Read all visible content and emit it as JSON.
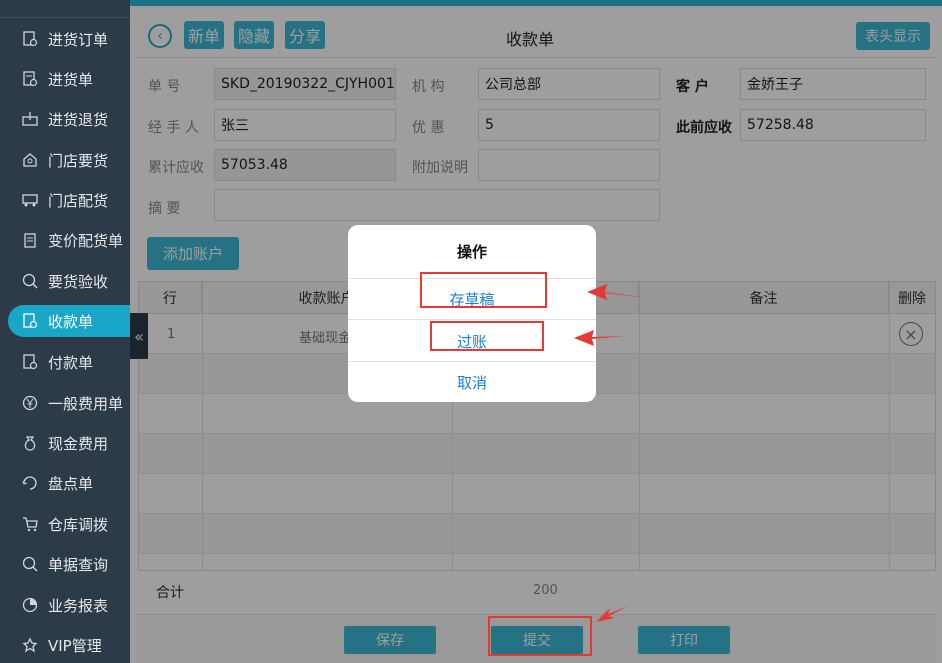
{
  "sidebar": {
    "items": [
      {
        "label": "进货订单",
        "icon": "purchase-order-icon"
      },
      {
        "label": "进货单",
        "icon": "purchase-icon"
      },
      {
        "label": "进货退货",
        "icon": "purchase-return-icon"
      },
      {
        "label": "门店要货",
        "icon": "store-request-icon"
      },
      {
        "label": "门店配货",
        "icon": "store-distribution-icon"
      },
      {
        "label": "变价配货单",
        "icon": "price-change-icon"
      },
      {
        "label": "要货验收",
        "icon": "acceptance-icon"
      },
      {
        "label": "收款单",
        "icon": "receipt-icon"
      },
      {
        "label": "付款单",
        "icon": "payment-icon"
      },
      {
        "label": "一般费用单",
        "icon": "yen-icon"
      },
      {
        "label": "现金费用",
        "icon": "cash-bag-icon"
      },
      {
        "label": "盘点单",
        "icon": "inventory-icon"
      },
      {
        "label": "仓库调拨",
        "icon": "warehouse-transfer-icon"
      },
      {
        "label": "单据查询",
        "icon": "search-doc-icon"
      },
      {
        "label": "业务报表",
        "icon": "pie-chart-icon"
      },
      {
        "label": "VIP管理",
        "icon": "vip-icon"
      }
    ],
    "active_index": 7
  },
  "header": {
    "buttons": [
      "新单",
      "隐藏",
      "分享"
    ],
    "title": "收款单",
    "display_button": "表头显示"
  },
  "form": {
    "doc_no_label": "单    号",
    "doc_no": "SKD_20190322_CJYH001",
    "org_label": "机    构",
    "org": "公司总部",
    "customer_label": "客    户",
    "customer": "金娇王子",
    "handler_label": "经 手 人",
    "handler": "张三",
    "discount_label": "优    惠",
    "discount": "5",
    "prev_receivable_label": "此前应收",
    "prev_receivable": "57258.48",
    "cum_receivable_label": "累计应收",
    "cum_receivable": "57053.48",
    "note_label": "附加说明",
    "note": "",
    "summary_label": "摘    要",
    "summary": ""
  },
  "add_account_button": "添加账户",
  "table": {
    "headers": [
      "行",
      "收款账户",
      "",
      "备注",
      "删除"
    ],
    "rows": [
      {
        "row": "1",
        "account": "基础现金",
        "amount": "",
        "remark": ""
      }
    ]
  },
  "totals": {
    "label": "合计",
    "amount": "200"
  },
  "footer": {
    "save": "保存",
    "submit": "提交",
    "print": "打印"
  },
  "dialog": {
    "title": "操作",
    "options": [
      "存草稿",
      "过账",
      "取消"
    ]
  },
  "colors": {
    "accent": "#3bb8d6",
    "sidebar_bg": "#2d3a47",
    "annotation_red": "#e53935",
    "option_blue": "#1a7fd6"
  }
}
